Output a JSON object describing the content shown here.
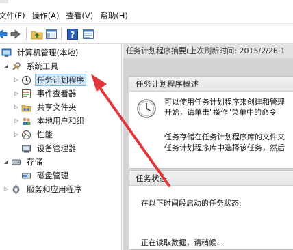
{
  "menu": {
    "items": [
      "文件(F)",
      "操作(A)",
      "查看(V)",
      "帮助(H)"
    ]
  },
  "toolbar": {
    "buttons": [
      "back-icon",
      "forward-icon",
      "up-folder-icon",
      "show-hide-tree-icon",
      "help-icon",
      "properties-icon"
    ]
  },
  "tree": {
    "root": "计算机管理(本地)",
    "system_tools": "系统工具",
    "task_scheduler": "任务计划程序",
    "event_viewer": "事件查看器",
    "shared_folders": "共享文件夹",
    "local_users": "本地用户和组",
    "performance": "性能",
    "device_manager": "设备管理器",
    "storage": "存储",
    "disk_management": "磁盘管理",
    "services_apps": "服务和应用程序"
  },
  "content": {
    "header": "任务计划程序摘要(上次刷新时间: 2015/2/26 1",
    "overview": {
      "title": "任务计划程序概述",
      "line1": "可以使用任务计划程序来创建和管理",
      "line2": "开始，请单击\"操作\"菜单中的命令",
      "line3": "任务存储在任务计划程序库的文件夹",
      "line4": "任务计划程序库中选择该任务，然后"
    },
    "status": {
      "title": "任务状态",
      "line1": "在以下时间段启动的任务状态:",
      "line2": "正在读取数据，请稍候..."
    }
  },
  "colors": {
    "selection": "#cce6f8",
    "annotation_arrow": "#e0383a",
    "pane_background": "#d4d4d4"
  }
}
